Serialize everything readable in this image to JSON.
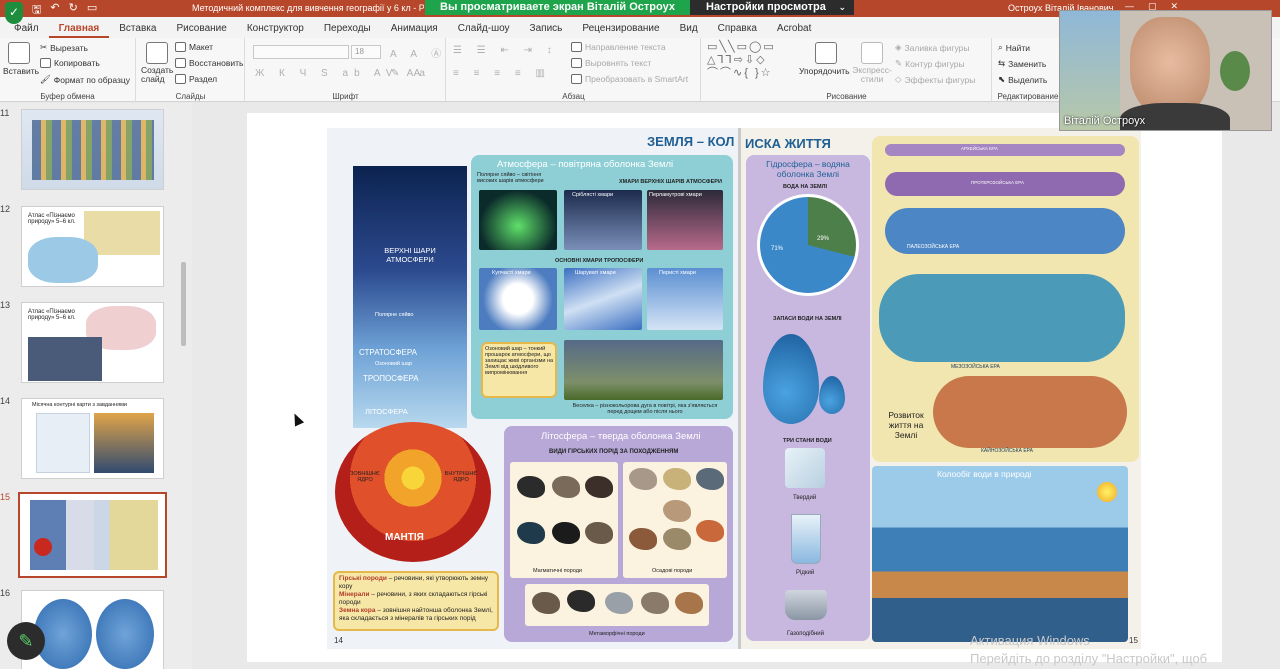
{
  "titlebar": {
    "doc_title": "Методичний комплекс для вивчення географії у 6 кл  -  PowerP",
    "share_banner": "Вы просматриваете экран Віталій Остроух",
    "view_settings": "Настройки просмотра",
    "user_name": "Остроух Віталій Іванович"
  },
  "tabs": [
    "Файл",
    "Главная",
    "Вставка",
    "Рисование",
    "Конструктор",
    "Переходы",
    "Анимация",
    "Слайд-шоу",
    "Запись",
    "Рецензирование",
    "Вид",
    "Справка",
    "Acrobat"
  ],
  "active_tab": "Главная",
  "ribbon": {
    "clipboard": {
      "paste": "Вставить",
      "cut": "Вырезать",
      "copy": "Копировать",
      "format": "Формат по образцу",
      "label": "Буфер обмена"
    },
    "slides": {
      "new_slide": "Создать слайд",
      "layout": "Макет",
      "reset": "Восстановить",
      "section": "Раздел",
      "label": "Слайды"
    },
    "font": {
      "size": "18",
      "label": "Шрифт"
    },
    "paragraph": {
      "text_direction": "Направление текста",
      "align_text": "Выровнять текст",
      "smartart": "Преобразовать в SmartArt",
      "label": "Абзац"
    },
    "drawing": {
      "arrange": "Упорядочить",
      "quick_styles": "Экспресс-стили",
      "fill": "Заливка фигуры",
      "outline": "Контур фигуры",
      "effects": "Эффекты фигуры",
      "label": "Рисование"
    },
    "editing": {
      "find": "Найти",
      "replace": "Заменить",
      "select": "Выделить",
      "label": "Редактирование"
    }
  },
  "thumbnails": [
    {
      "num": "11",
      "title": ""
    },
    {
      "num": "12",
      "title": "Атлас «Пізнаємо природу» 5–6 кл."
    },
    {
      "num": "13",
      "title": "Атлас «Пізнаємо природу» 5–6 кл."
    },
    {
      "num": "14",
      "title": "Місячна контурні карти з завданнями"
    },
    {
      "num": "15",
      "title": ""
    },
    {
      "num": "16",
      "title": ""
    }
  ],
  "slide": {
    "heading_left": "ЗЕМЛЯ – КОЛ",
    "heading_right": "ИСКА ЖИТТЯ",
    "atmosphere": {
      "title": "Атмосфера – повітряна оболонка Землі",
      "aurora": "Полярне сяйво – світіння високих шарів атмосфери",
      "upper_clouds": "ХМАРИ ВЕРХНІХ ШАРІВ АТМОСФЕРИ",
      "silvery": "Сріблясті хмари",
      "pearl": "Перламутрові хмари",
      "tropo_clouds": "ОСНОВНІ ХМАРИ ТРОПОСФЕРИ",
      "cumulus": "Купчасті хмари",
      "stratus": "Шаруваті хмари",
      "cirrus": "Перисті хмари",
      "ozone": "Озоновий шар – тонкий прошарок атмосфери, що захищає живі організми на Землі від шкідливого випромінювання",
      "rainbow": "Веселка – різнокольорова дуга в повітрі, яка з'являється перед дощем або після нього"
    },
    "column": {
      "upper": "ВЕРХНІ ШАРИ АТМОСФЕРИ",
      "aurora": "Полярне сяйво",
      "strato": "СТРАТОСФЕРА",
      "ozone": "Озоновий шар",
      "tropo": "ТРОПОСФЕРА",
      "litho": "ЛІТОСФЕРА",
      "mantle": "МАНТІЯ",
      "outer_core": "ЗОВНІШНЄ ЯДРО",
      "inner_core": "ВНУТРІШНЄ ЯДРО"
    },
    "lithosphere": {
      "title": "Літосфера – тверда оболонка Землі",
      "rock_types": "ВИДИ ГІРСЬКИХ ПОРІД ЗА ПОХОДЖЕННЯМ",
      "magmatic": "Магматичні породи",
      "sedimentary": "Осадові породи",
      "metamorphic": "Метаморфічні породи",
      "rocks_def_term": "Гірські породи",
      "rocks_def": "– речовини, які утворюють земну кору",
      "minerals_term": "Мінерали",
      "minerals_def": "– речовини, з яких складаються гірські породи",
      "crust_term": "Земна кора",
      "crust_def": "– зовнішня найтонша оболонка Землі, яка складається з мінералів та гірських порід"
    },
    "hydrosphere": {
      "title": "Гідросфера – водяна оболонка Землі",
      "water_on_earth": "ВОДА НА ЗЕМЛІ",
      "reserves": "ЗАПАСИ ВОДИ НА ЗЕМЛІ",
      "states": "ТРИ СТАНИ ВОДИ",
      "solid": "Твердий",
      "liquid": "Рідкий",
      "gas": "Газоподібний",
      "pct_land": "29%",
      "pct_water": "71%"
    },
    "life": {
      "archean": "АРХЕЙСЬКА ЕРА",
      "proterozoic": "ПРОТЕРОЗОЙСЬКА ЕРА",
      "paleozoic": "ПАЛЕОЗОЙСЬКА ЕРА",
      "mesozoic": "МЕЗОЗОЙСЬКА ЕРА",
      "cenozoic": "КАЙНОЗОЙСЬКА ЕРА",
      "title": "Розвиток життя на Землі"
    },
    "water_cycle": {
      "title": "Колообіг води в природі"
    },
    "page_left": "14",
    "page_right": "15"
  },
  "video": {
    "name": "Віталій Остроух"
  },
  "watermark": {
    "line1": "Активация Windows",
    "line2": "Перейдіть до розділу \"Настройки\", щоб"
  },
  "colors": {
    "accent": "#b7472a",
    "share": "#1ea44b",
    "atmosphere_box": "#8ecfd6",
    "litho_box": "#b7a8d8",
    "hydro_box": "#c8b8e0",
    "life_box": "#f2e6b0"
  }
}
